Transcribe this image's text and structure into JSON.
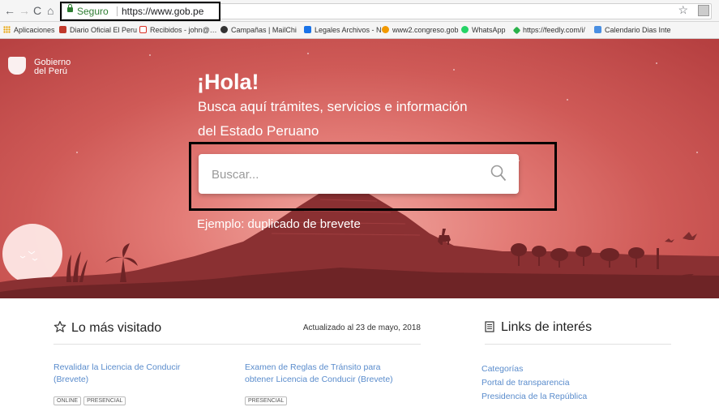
{
  "browser": {
    "secure_label": "Seguro",
    "url": "https://www.gob.pe",
    "back_icon": "arrow-left-icon",
    "forward_icon": "arrow-right-icon",
    "reload_icon": "reload-icon",
    "home_icon": "home-icon",
    "bookmark_star_icon": "star-icon"
  },
  "bookmarks": [
    {
      "label": "Aplicaciones",
      "icon_color": "#e8a000"
    },
    {
      "label": "Diario Oficial El Peru",
      "icon_color": "#c0392b"
    },
    {
      "label": "Recibidos - john@…",
      "icon_color": "#d93025"
    },
    {
      "label": "Campañas | MailChi",
      "icon_color": "#333333"
    },
    {
      "label": "Legales Archivos - N",
      "icon_color": "#1a73e8"
    },
    {
      "label": "www2.congreso.gob",
      "icon_color": "#f29900"
    },
    {
      "label": "WhatsApp",
      "icon_color": "#25d366"
    },
    {
      "label": "https://feedly.com/i/",
      "icon_color": "#2bb24c"
    },
    {
      "label": "Calendario Dias Inte",
      "icon_color": "#4a8fe2"
    }
  ],
  "hero": {
    "logo_line1": "Gobierno",
    "logo_line2": "del Perú",
    "greeting": "¡Hola!",
    "subtitle_line1": "Busca aquí trámites, servicios e información",
    "subtitle_line2": "del Estado Peruano",
    "search_placeholder": "Buscar...",
    "example": "Ejemplo: duplicado de brevete",
    "colors": {
      "bg_dark": "#b43e3f",
      "bg_light": "#f0a7a0",
      "silhouette": "#7e2c2e"
    }
  },
  "most_visited": {
    "title": "Lo más visitado",
    "updated": "Actualizado al 23 de mayo, 2018",
    "items": [
      {
        "line1": "Revalidar la Licencia de Conducir",
        "line2": "(Brevete)",
        "badges": [
          "ONLINE",
          "PRESENCIAL"
        ]
      },
      {
        "line1": "Examen de Reglas de Tránsito para",
        "line2": "obtener Licencia de Conducir (Brevete)",
        "badges": [
          "PRESENCIAL"
        ]
      }
    ]
  },
  "links_interest": {
    "title": "Links de interés",
    "items": [
      "Categorías",
      "Portal de transparencia",
      "Presidencia de la República"
    ]
  },
  "link_color": "#5a8ccc"
}
